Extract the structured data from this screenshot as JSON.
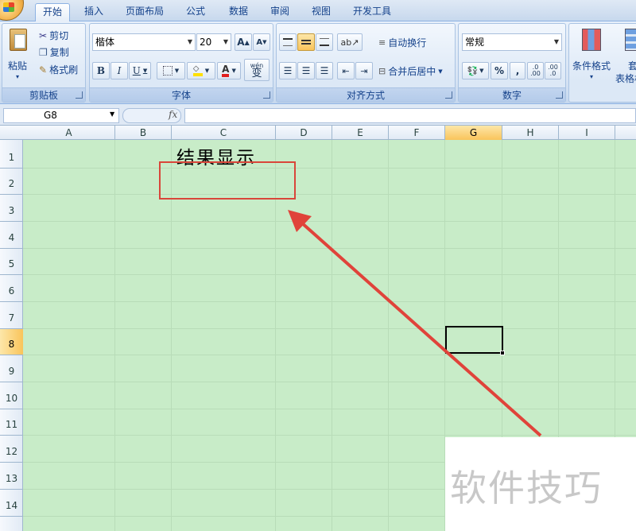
{
  "tabs": [
    "开始",
    "插入",
    "页面布局",
    "公式",
    "数据",
    "审阅",
    "视图",
    "开发工具"
  ],
  "clipboard": {
    "paste": "粘贴",
    "cut": "剪切",
    "copy": "复制",
    "format_painter": "格式刷",
    "label": "剪贴板"
  },
  "font": {
    "name": "楷体",
    "size": "20",
    "grow": "A",
    "shrink": "A",
    "bold": "B",
    "italic": "I",
    "underline": "U",
    "color_letter": "A",
    "phonetic": "wén",
    "phonetic_char": "变",
    "label": "字体"
  },
  "alignment": {
    "wrap_text": "自动换行",
    "merge_center": "合并后居中",
    "label": "对齐方式"
  },
  "number": {
    "format": "常规",
    "percent": "%",
    "comma": ",",
    "inc_decimal": ".0 .00",
    "dec_decimal": ".00 .0",
    "label": "数字"
  },
  "styles": {
    "conditional_format": "条件格式",
    "table_format": "套",
    "table_format_2": "表格格"
  },
  "formula_bar": {
    "name_box": "G8",
    "fx": "fx",
    "value": ""
  },
  "columns": [
    "A",
    "B",
    "C",
    "D",
    "E",
    "F",
    "G",
    "H",
    "I"
  ],
  "rows": [
    "1",
    "2",
    "3",
    "4",
    "5",
    "6",
    "7",
    "8",
    "9",
    "10",
    "11",
    "12",
    "13",
    "14"
  ],
  "selected_cell": "G8",
  "cells": {
    "C1": "结果显示"
  },
  "watermark": "软件技巧",
  "colors": {
    "annotation": "#d9463a",
    "sheet_bg": "#c8ecc8"
  }
}
